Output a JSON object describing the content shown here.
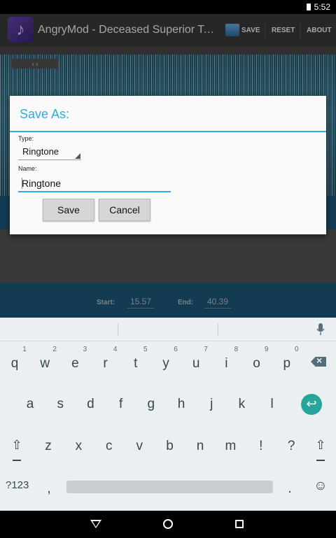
{
  "status_bar": {
    "time": "5:52"
  },
  "action_bar": {
    "app_icon": "music-note-icon",
    "title": "AngryMod - Deceased Superior Techni...",
    "save_label": "SAVE",
    "reset_label": "RESET",
    "about_label": "ABOUT"
  },
  "editor": {
    "start_label": "Start:",
    "start_value": "15.57",
    "end_label": "End:",
    "end_value": "40.39"
  },
  "dialog": {
    "title": "Save As:",
    "type_label": "Type:",
    "type_value": "Ringtone",
    "name_label": "Name:",
    "name_value": "Ringtone",
    "save_button": "Save",
    "cancel_button": "Cancel"
  },
  "keyboard": {
    "row1": [
      "q",
      "w",
      "e",
      "r",
      "t",
      "y",
      "u",
      "i",
      "o",
      "p"
    ],
    "row1_hints": [
      "1",
      "2",
      "3",
      "4",
      "5",
      "6",
      "7",
      "8",
      "9",
      "0"
    ],
    "row2": [
      "a",
      "s",
      "d",
      "f",
      "g",
      "h",
      "j",
      "k",
      "l"
    ],
    "row3": [
      "z",
      "x",
      "c",
      "v",
      "b",
      "n",
      "m",
      "!",
      "?"
    ],
    "symbols_key": "?123",
    "comma": ",",
    "period": ".",
    "emoji": "☺",
    "enter_icon": "↩",
    "shift_icon": "⇧"
  },
  "colors": {
    "accent": "#33aadd",
    "enter_key": "#26a69a",
    "actionbar": "#3d3d3d"
  }
}
